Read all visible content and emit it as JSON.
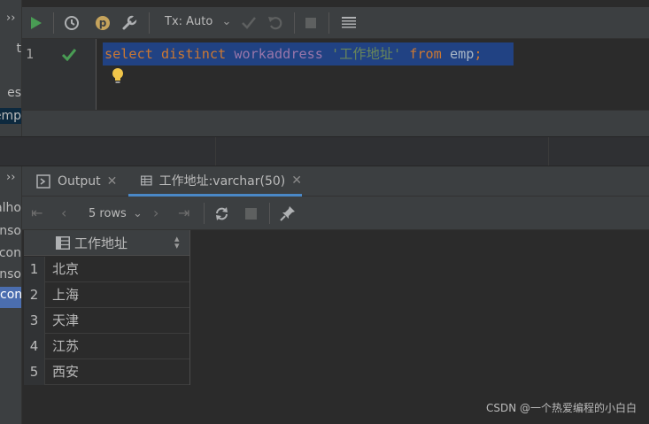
{
  "left_strip": {
    "items": [
      "t",
      "es",
      "emp",
      "alho",
      "nso",
      "con",
      "nso",
      "con"
    ],
    "chevron_top": "››",
    "chevron_mid": "››"
  },
  "toolbar": {
    "tx_mode": "Tx: Auto"
  },
  "editor": {
    "line_number": "1",
    "tokens": [
      {
        "cls": "kw",
        "text": "select "
      },
      {
        "cls": "kw",
        "text": "distinct "
      },
      {
        "cls": "id",
        "text": "workaddress "
      },
      {
        "cls": "str",
        "text": "'工作地址' "
      },
      {
        "cls": "kw",
        "text": "from "
      },
      {
        "cls": "plain",
        "text": "emp"
      },
      {
        "cls": "kw",
        "text": ";"
      }
    ]
  },
  "results": {
    "tabs": [
      {
        "label": "Output"
      },
      {
        "label": "工作地址:varchar(50)"
      }
    ],
    "rows_label": "5 rows",
    "column_header": "工作地址",
    "rows": [
      {
        "num": "1",
        "value": "北京"
      },
      {
        "num": "2",
        "value": "上海"
      },
      {
        "num": "3",
        "value": "天津"
      },
      {
        "num": "4",
        "value": "江苏"
      },
      {
        "num": "5",
        "value": "西安"
      }
    ]
  },
  "watermark": "CSDN @一个热爱编程的小白白",
  "colors": {
    "accent_run": "#499c54",
    "selection": "#214283",
    "keyword": "#cc7832",
    "identifier": "#9876aa",
    "string": "#6a8759"
  }
}
